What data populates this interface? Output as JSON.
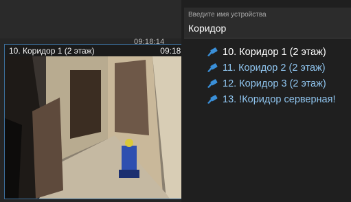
{
  "search": {
    "label": "Введите имя устройства",
    "value": "Коридор"
  },
  "tile": {
    "title": "10. Коридор 1 (2 этаж)",
    "time": "09:18:14",
    "background_time": "09:18:14"
  },
  "devices": [
    {
      "label": "10. Коридор 1 (2 этаж)",
      "icon": "camera-icon",
      "active": true
    },
    {
      "label": "11. Коридор 2 (2 этаж)",
      "icon": "camera-icon",
      "active": false
    },
    {
      "label": "12. Коридор 3 (2 этаж)",
      "icon": "camera-icon",
      "active": false
    },
    {
      "label": "13. !Коридор серверная!",
      "icon": "camera-icon",
      "active": false
    }
  ],
  "colors": {
    "accent": "#3a8fd8",
    "tile_border": "#3c6e9a"
  }
}
